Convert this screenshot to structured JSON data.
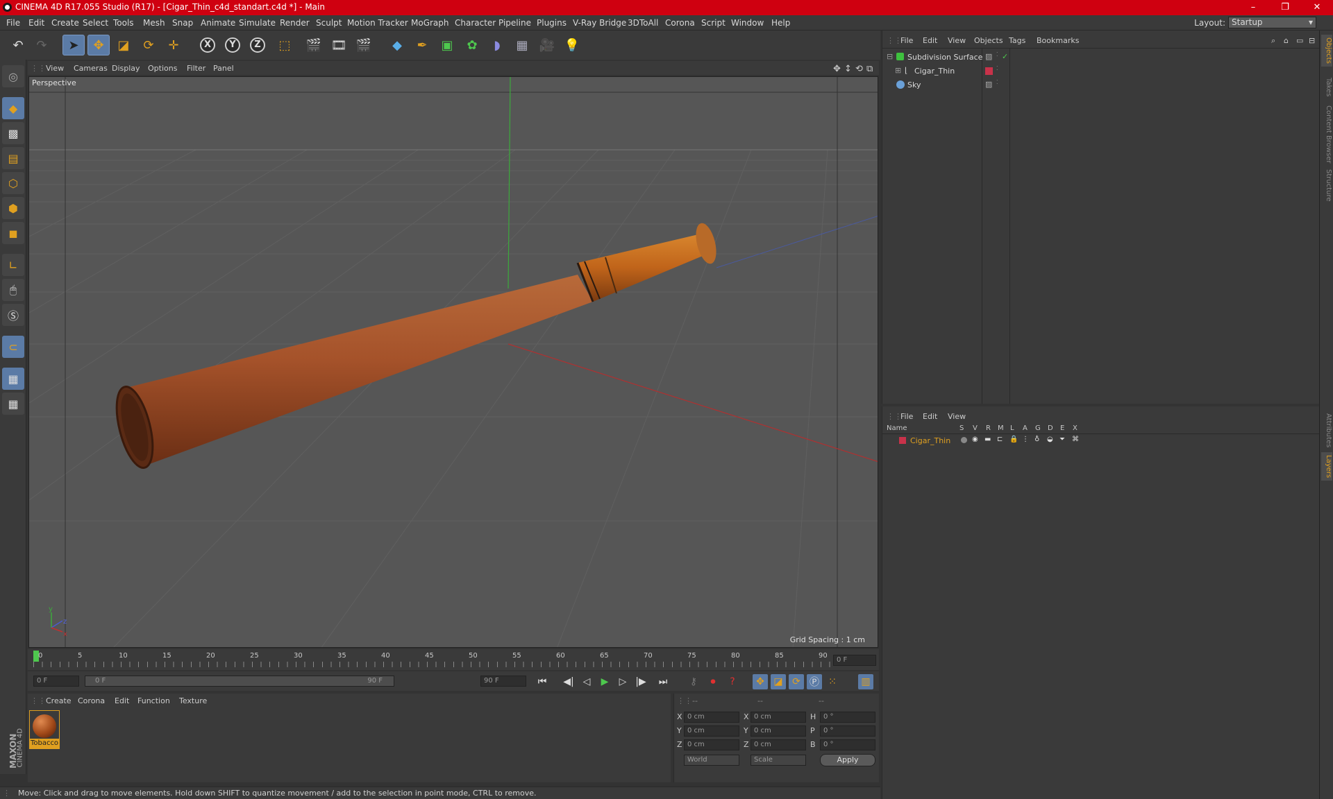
{
  "window": {
    "title": "CINEMA 4D R17.055 Studio (R17) - [Cigar_Thin_c4d_standart.c4d *] - Main",
    "minimize": "–",
    "maximize": "❐",
    "close": "✕"
  },
  "menubar": [
    "File",
    "Edit",
    "Create",
    "Select",
    "Tools",
    "Mesh",
    "Snap",
    "Animate",
    "Simulate",
    "Render",
    "Sculpt",
    "Motion Tracker",
    "MoGraph",
    "Character",
    "Pipeline",
    "Plugins",
    "V-Ray Bridge",
    "3DToAll",
    "Corona",
    "Script",
    "Window",
    "Help"
  ],
  "layout": {
    "label": "Layout:",
    "value": "Startup"
  },
  "toolbar": {
    "undo_icon": "undo-icon",
    "redo_icon": "redo-icon",
    "axis_x": "X",
    "axis_y": "Y",
    "axis_z": "Z"
  },
  "viewport": {
    "menu": [
      "View",
      "Cameras",
      "Display",
      "Options",
      "Filter",
      "Panel"
    ],
    "camera": "Perspective",
    "grid_spacing": "Grid Spacing : 1 cm",
    "axis_y": "y",
    "axis_z": "z",
    "axis_x": "x"
  },
  "timeline": {
    "ticks": [
      "0",
      "5",
      "10",
      "15",
      "20",
      "25",
      "30",
      "35",
      "40",
      "45",
      "50",
      "55",
      "60",
      "65",
      "70",
      "75",
      "80",
      "85",
      "90"
    ],
    "current_frame": "0 F",
    "start_field": "0 F",
    "range_start": "0 F",
    "range_end": "90 F",
    "end_field": "90 F"
  },
  "materials": {
    "menu": [
      "Create",
      "Corona",
      "Edit",
      "Function",
      "Texture"
    ],
    "items": [
      {
        "name": "Tobacco"
      }
    ]
  },
  "coords": {
    "header": [
      "--",
      "--",
      "--"
    ],
    "rows": [
      {
        "a": "X",
        "av": "0 cm",
        "b": "X",
        "bv": "0 cm",
        "c": "H",
        "cv": "0 °"
      },
      {
        "a": "Y",
        "av": "0 cm",
        "b": "Y",
        "bv": "0 cm",
        "c": "P",
        "cv": "0 °"
      },
      {
        "a": "Z",
        "av": "0 cm",
        "b": "Z",
        "bv": "0 cm",
        "c": "B",
        "cv": "0 °"
      }
    ],
    "mode": "World",
    "type": "Scale",
    "apply": "Apply"
  },
  "object_manager": {
    "menu": [
      "File",
      "Edit",
      "View",
      "Objects",
      "Tags",
      "Bookmarks"
    ],
    "objects": [
      {
        "name": "Subdivision Surface",
        "color": "#3ec03e"
      },
      {
        "name": "Cigar_Thin",
        "color": "#d8d8d8"
      },
      {
        "name": "Sky",
        "color": "#6aa0d8"
      }
    ]
  },
  "layer_manager": {
    "menu": [
      "File",
      "Edit",
      "View"
    ],
    "columns": [
      "Name",
      "S",
      "V",
      "R",
      "M",
      "L",
      "A",
      "G",
      "D",
      "E",
      "X"
    ],
    "layers": [
      {
        "name": "Cigar_Thin",
        "color": "#c8324a"
      }
    ]
  },
  "side_tabs": [
    "Objects",
    "Takes",
    "Content Browser",
    "Structure",
    "Attributes",
    "Layers"
  ],
  "brand": {
    "maxon": "MAXON",
    "product": "CINEMA 4D"
  },
  "status": "Move: Click and drag to move elements. Hold down SHIFT to quantize movement / add to the selection in point mode, CTRL to remove.",
  "colors": {
    "accent": "#e0a020",
    "title_bar": "#cf0010",
    "selection": "#5b7ba6"
  }
}
